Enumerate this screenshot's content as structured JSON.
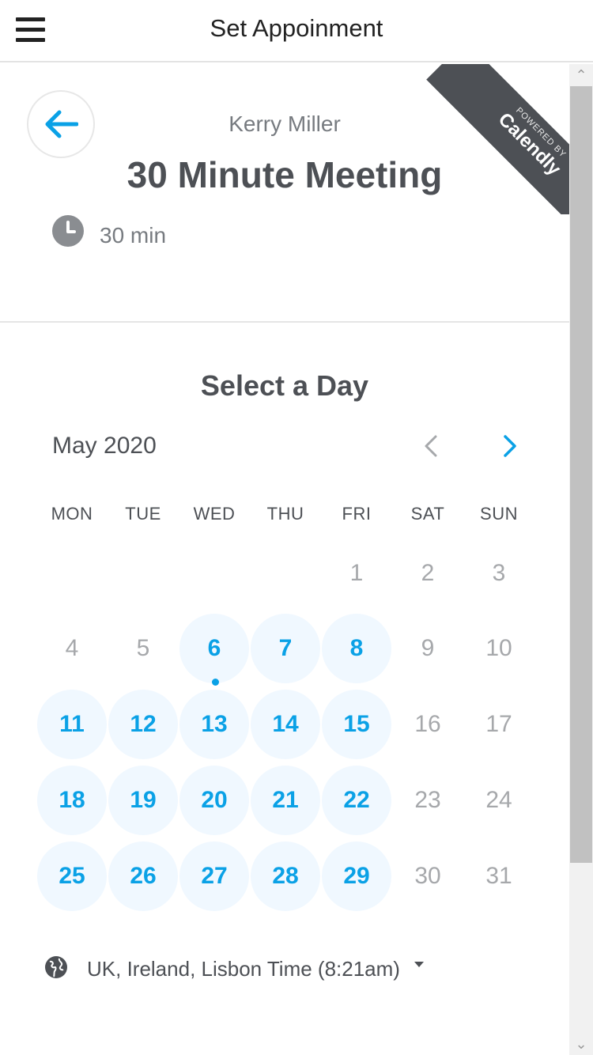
{
  "appbar": {
    "title": "Set Appoinment"
  },
  "event": {
    "host": "Kerry Miller",
    "title": "30 Minute Meeting",
    "duration": "30 min"
  },
  "ribbon": {
    "powered_by": "POWERED BY",
    "brand": "Calendly"
  },
  "calendar": {
    "heading": "Select a Day",
    "month": "May 2020",
    "weekdays": [
      "MON",
      "TUE",
      "WED",
      "THU",
      "FRI",
      "SAT",
      "SUN"
    ],
    "weeks": [
      [
        "",
        "",
        "",
        "",
        "1",
        "2",
        "3"
      ],
      [
        "4",
        "5",
        "6",
        "7",
        "8",
        "9",
        "10"
      ],
      [
        "11",
        "12",
        "13",
        "14",
        "15",
        "16",
        "17"
      ],
      [
        "18",
        "19",
        "20",
        "21",
        "22",
        "23",
        "24"
      ],
      [
        "25",
        "26",
        "27",
        "28",
        "29",
        "30",
        "31"
      ]
    ],
    "available_days": [
      "6",
      "7",
      "8",
      "11",
      "12",
      "13",
      "14",
      "15",
      "18",
      "19",
      "20",
      "21",
      "22",
      "25",
      "26",
      "27",
      "28",
      "29"
    ],
    "today": "6"
  },
  "timezone": {
    "label": "UK, Ireland, Lisbon Time (8:21am)"
  },
  "colors": {
    "accent": "#0aa1e6",
    "available_bg": "#f0f8ff",
    "text": "#4d5055",
    "ribbon": "#4d5055"
  },
  "icons": {
    "menu": "hamburger-icon",
    "back": "arrow-left-icon",
    "duration": "clock-icon",
    "prev": "chevron-left-icon",
    "next": "chevron-right-icon",
    "timezone": "globe-icon",
    "dropdown": "caret-down-icon"
  }
}
